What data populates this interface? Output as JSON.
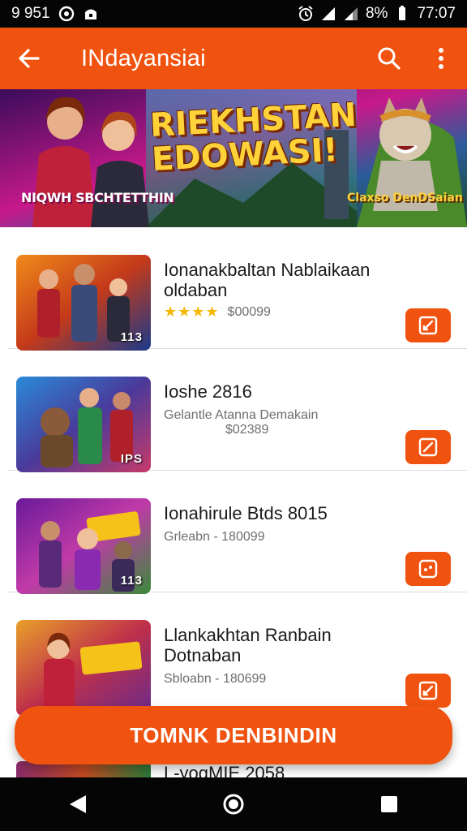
{
  "status_bar": {
    "left_text": "9 951",
    "battery": "8%",
    "time": "77:07",
    "icons": [
      "alarm-icon",
      "signal-icon",
      "battery-icon"
    ]
  },
  "app_bar": {
    "title": "INdayansiai",
    "icons": [
      "back-arrow-icon",
      "search-icon",
      "more-vert-icon"
    ]
  },
  "banner": {
    "headline": "RIEKHSTAN EDOWASI!",
    "left_tag": "NIQWH SBCHTETTHIN",
    "right_tag": "Claxso DenDSaian"
  },
  "items": [
    {
      "name": "Ionanakbaltan Nablaikaan oldaban",
      "rating": "★★★★",
      "price": "$00099",
      "code": "113",
      "action_icon": "edit-icon"
    },
    {
      "name": "Ioshe 2816",
      "subtitle": "Gelantle Atanna Demakain",
      "price": "$02389",
      "code": "IPS",
      "action_icon": "edit-icon"
    },
    {
      "name": "Ionahirule Btds 8015",
      "subtitle": "Grleabn - 180099",
      "code": "113",
      "action_icon": "gamepad-icon"
    },
    {
      "name": "Llankakhtan Ranbain Dotnaban",
      "subtitle": "Sbloabn - 180699",
      "action_icon": "edit-icon"
    }
  ],
  "peek_item": {
    "name": "L-yogMIE 2058"
  },
  "cta": {
    "label": "TOMNK DENBINDIN"
  },
  "nav": {
    "icons": [
      "back-triangle-icon",
      "home-circle-icon",
      "recents-square-icon"
    ]
  },
  "colors": {
    "accent": "#f0530f",
    "status_bar": "#050505",
    "star": "#f5b700"
  }
}
